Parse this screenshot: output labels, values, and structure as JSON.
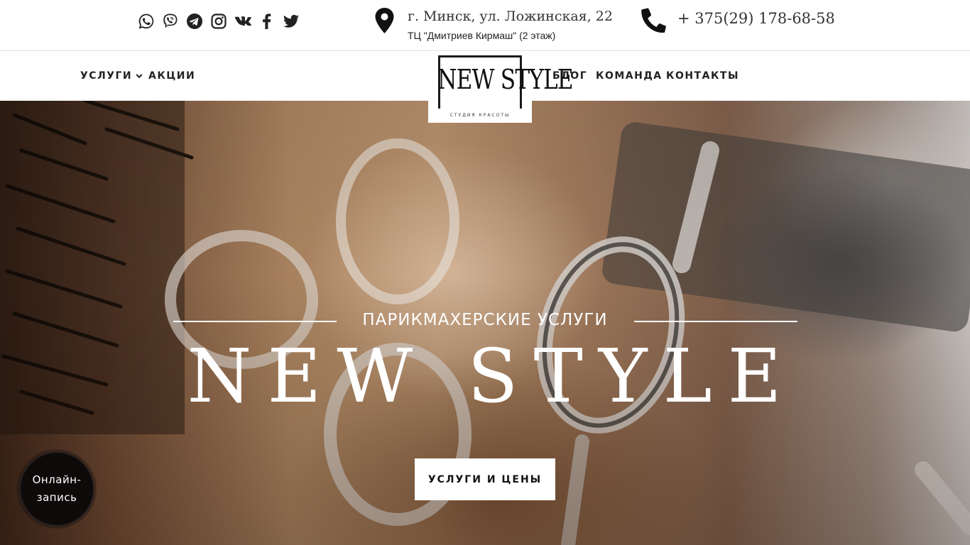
{
  "topbar": {
    "socials": [
      {
        "icon": "whatsapp-icon"
      },
      {
        "icon": "viber-icon"
      },
      {
        "icon": "telegram-icon"
      },
      {
        "icon": "instagram-icon"
      },
      {
        "icon": "vk-icon"
      },
      {
        "icon": "facebook-icon"
      },
      {
        "icon": "twitter-icon"
      }
    ],
    "address_main": "г. Минск, ул. Ложинская, 22",
    "address_sub": "ТЦ \"Дмитриев Кирмаш\" (2 этаж)",
    "phone": "+ 375(29) 178-68-58"
  },
  "nav": {
    "services": "УСЛУГИ",
    "promos": "АКЦИИ",
    "blog": "БЛОГ",
    "team": "КОМАНДА",
    "contacts": "КОНТАКТЫ"
  },
  "logo": {
    "title": "NEW STYLE",
    "subtitle": "СТУДИЯ КРАСОТЫ"
  },
  "hero": {
    "subtitle": "ПАРИКМАХЕРСКИЕ УСЛУГИ",
    "title": "NEW STYLE",
    "cta_label": "УСЛУГИ И ЦЕНЫ"
  },
  "online_booking": {
    "label": "Онлайн-запись"
  },
  "colors": {
    "text_dark": "#1a1a1a",
    "hero_text": "#ffffff",
    "booking_bg": "#0f0a0a"
  }
}
